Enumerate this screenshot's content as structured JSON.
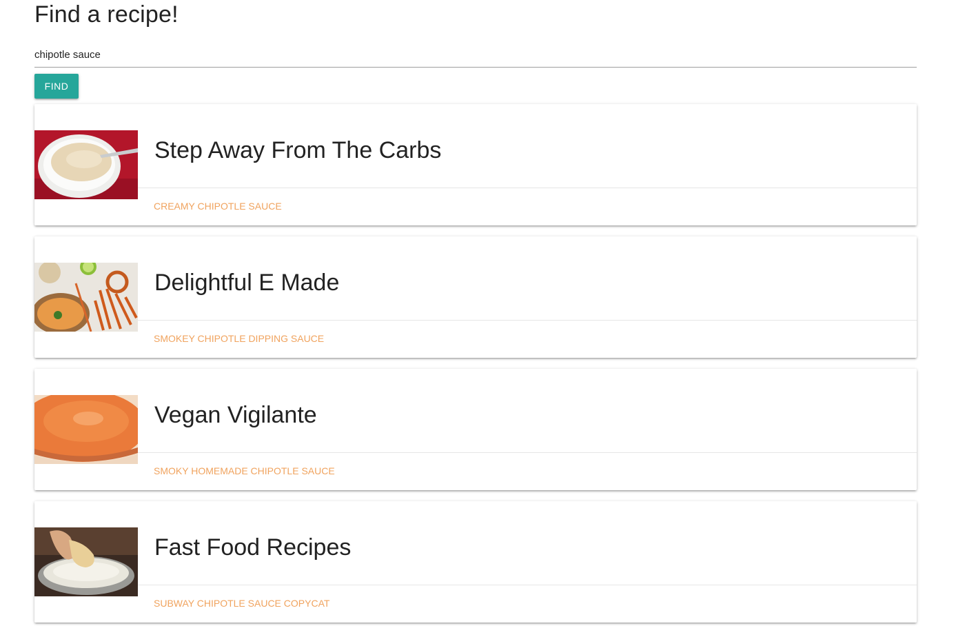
{
  "header": {
    "title": "Find a recipe!"
  },
  "search": {
    "value": "chipotle sauce",
    "button_label": "FIND"
  },
  "colors": {
    "button": "#26a69a",
    "link": "#f0a35e"
  },
  "results": [
    {
      "source": "Step Away From The Carbs",
      "recipe": "CREAMY CHIPOTLE SAUCE",
      "image": "creamy-sauce-bowl"
    },
    {
      "source": "Delightful E Made",
      "recipe": "SMOKEY CHIPOTLE DIPPING SAUCE",
      "image": "dipping-sauce-with-fries"
    },
    {
      "source": "Vegan Vigilante",
      "recipe": "SMOKY HOMEMADE CHIPOTLE SAUCE",
      "image": "orange-sauce-jar"
    },
    {
      "source": "Fast Food Recipes",
      "recipe": "SUBWAY CHIPOTLE SAUCE COPYCAT",
      "image": "bread-dipped-sauce"
    }
  ]
}
